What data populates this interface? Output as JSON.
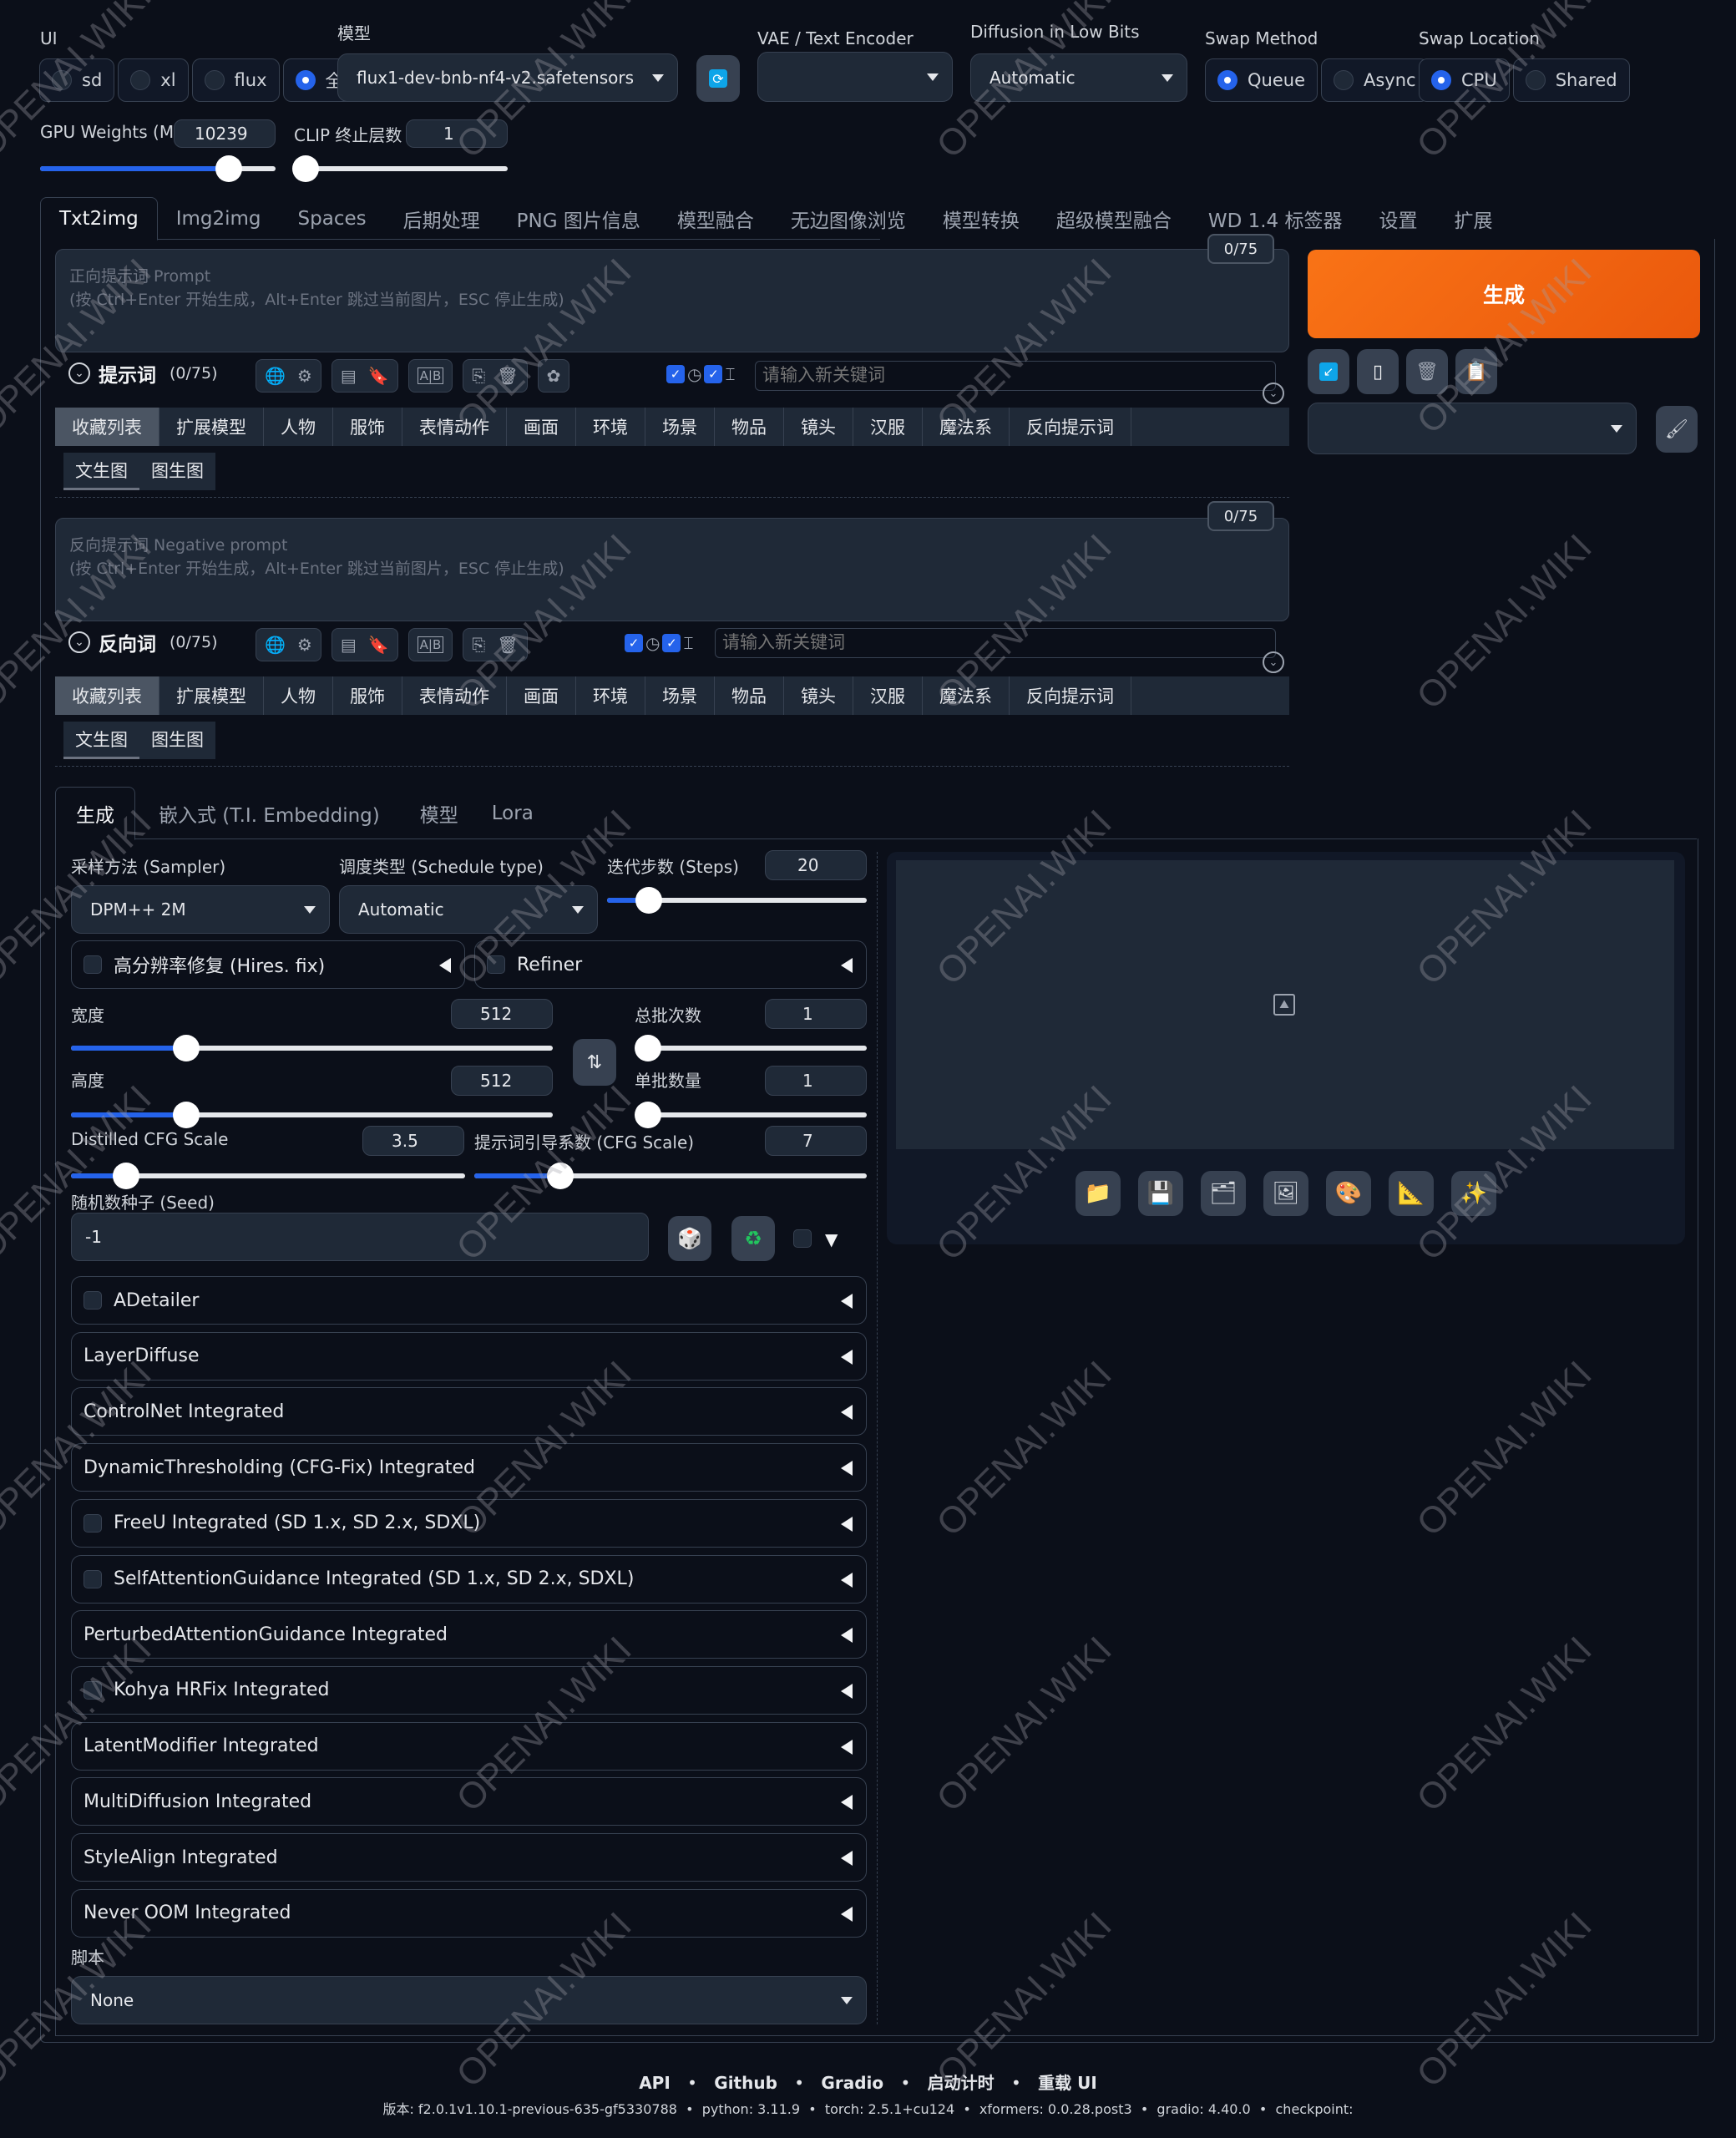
{
  "top": {
    "ui_label": "UI",
    "ui_options": [
      {
        "label": "sd",
        "selected": false
      },
      {
        "label": "xl",
        "selected": false
      },
      {
        "label": "flux",
        "selected": false
      },
      {
        "label": "全部",
        "selected": true
      }
    ],
    "model_label": "模型",
    "model_value": "flux1-dev-bnb-nf4-v2.safetensors",
    "vae_label": "VAE / Text Encoder",
    "vae_value": "",
    "lowbits_label": "Diffusion in Low Bits",
    "lowbits_value": "Automatic",
    "swap_method_label": "Swap Method",
    "swap_method_options": [
      {
        "label": "Queue",
        "selected": true
      },
      {
        "label": "Async",
        "selected": false
      }
    ],
    "swap_location_label": "Swap Location",
    "swap_location_options": [
      {
        "label": "CPU",
        "selected": true
      },
      {
        "label": "Shared",
        "selected": false
      }
    ],
    "gpu_weights_label": "GPU Weights (MB)",
    "gpu_weights_value": "10239",
    "gpu_weights_fraction": 0.8,
    "clip_label": "CLIP 终止层数",
    "clip_value": "1",
    "clip_fraction": 0.0
  },
  "tabs": [
    "Txt2img",
    "Img2img",
    "Spaces",
    "后期处理",
    "PNG 图片信息",
    "模型融合",
    "无边图像浏览",
    "模型转换",
    "超级模型融合",
    "WD 1.4 标签器",
    "设置",
    "扩展"
  ],
  "active_tab": "Txt2img",
  "prompt": {
    "counter": "0/75",
    "placeholder_line1": "正向提示词 Prompt",
    "placeholder_line2": "(按 Ctrl+Enter 开始生成，Alt+Enter 跳过当前图片，ESC 停止生成)",
    "section_title": "提示词",
    "section_count": "(0/75)",
    "keyword_placeholder": "请输入新关键词"
  },
  "negative": {
    "counter": "0/75",
    "placeholder_line1": "反向提示词 Negative prompt",
    "placeholder_line2": "(按 Ctrl+Enter 开始生成，Alt+Enter 跳过当前图片，ESC 停止生成)",
    "section_title": "反向词",
    "section_count": "(0/75)",
    "keyword_placeholder": "请输入新关键词"
  },
  "tag_categories": [
    "收藏列表",
    "扩展模型",
    "人物",
    "服饰",
    "表情动作",
    "画面",
    "环境",
    "场景",
    "物品",
    "镜头",
    "汉服",
    "魔法系",
    "反向提示词"
  ],
  "sub_tags": [
    "文生图",
    "图生图"
  ],
  "generate_label": "生成",
  "subtabs": [
    "生成",
    "嵌入式 (T.I. Embedding)",
    "模型",
    "Lora"
  ],
  "params": {
    "sampler_label": "采样方法 (Sampler)",
    "sampler_value": "DPM++ 2M",
    "schedule_label": "调度类型 (Schedule type)",
    "schedule_value": "Automatic",
    "steps_label": "迭代步数 (Steps)",
    "steps_value": "20",
    "steps_fraction": 0.16,
    "hires_label": "高分辨率修复 (Hires. fix)",
    "refiner_label": "Refiner",
    "width_label": "宽度",
    "width_value": "512",
    "width_fraction": 0.24,
    "height_label": "高度",
    "height_value": "512",
    "height_fraction": 0.24,
    "batch_count_label": "总批次数",
    "batch_count_value": "1",
    "batch_count_fraction": 0.0,
    "batch_size_label": "单批数量",
    "batch_size_value": "1",
    "batch_size_fraction": 0.0,
    "dcfg_label": "Distilled CFG Scale",
    "dcfg_value": "3.5",
    "dcfg_fraction": 0.14,
    "cfg_label": "提示词引导系数 (CFG Scale)",
    "cfg_value": "7",
    "cfg_fraction": 0.22,
    "seed_label": "随机数种子 (Seed)",
    "seed_value": "-1"
  },
  "accordions": [
    {
      "label": "ADetailer",
      "checkbox": true
    },
    {
      "label": "LayerDiffuse",
      "checkbox": false
    },
    {
      "label": "ControlNet Integrated",
      "checkbox": false
    },
    {
      "label": "DynamicThresholding (CFG-Fix) Integrated",
      "checkbox": false
    },
    {
      "label": "FreeU Integrated (SD 1.x, SD 2.x, SDXL)",
      "checkbox": true
    },
    {
      "label": "SelfAttentionGuidance Integrated (SD 1.x, SD 2.x, SDXL)",
      "checkbox": true
    },
    {
      "label": "PerturbedAttentionGuidance Integrated",
      "checkbox": false
    },
    {
      "label": "Kohya HRFix Integrated",
      "checkbox": true
    },
    {
      "label": "LatentModifier Integrated",
      "checkbox": false
    },
    {
      "label": "MultiDiffusion Integrated",
      "checkbox": false
    },
    {
      "label": "StyleAlign Integrated",
      "checkbox": false
    },
    {
      "label": "Never OOM Integrated",
      "checkbox": false
    }
  ],
  "script_label": "脚本",
  "script_value": "None",
  "output_tools": [
    "folder-icon",
    "save-icon",
    "zip-icon",
    "image-icon",
    "palette-icon",
    "ruler-icon",
    "sparkles-icon"
  ],
  "footer": {
    "links": [
      "API",
      "Github",
      "Gradio",
      "启动计时",
      "重载 UI"
    ],
    "version": "版本: f2.0.1v1.10.1-previous-635-gf5330788",
    "python": "python: 3.11.9",
    "torch": "torch: 2.5.1+cu124",
    "xformers": "xformers: 0.0.28.post3",
    "gradio": "gradio: 4.40.0",
    "checkpoint": "checkpoint:"
  },
  "watermark": "OPENAI.WIKI"
}
